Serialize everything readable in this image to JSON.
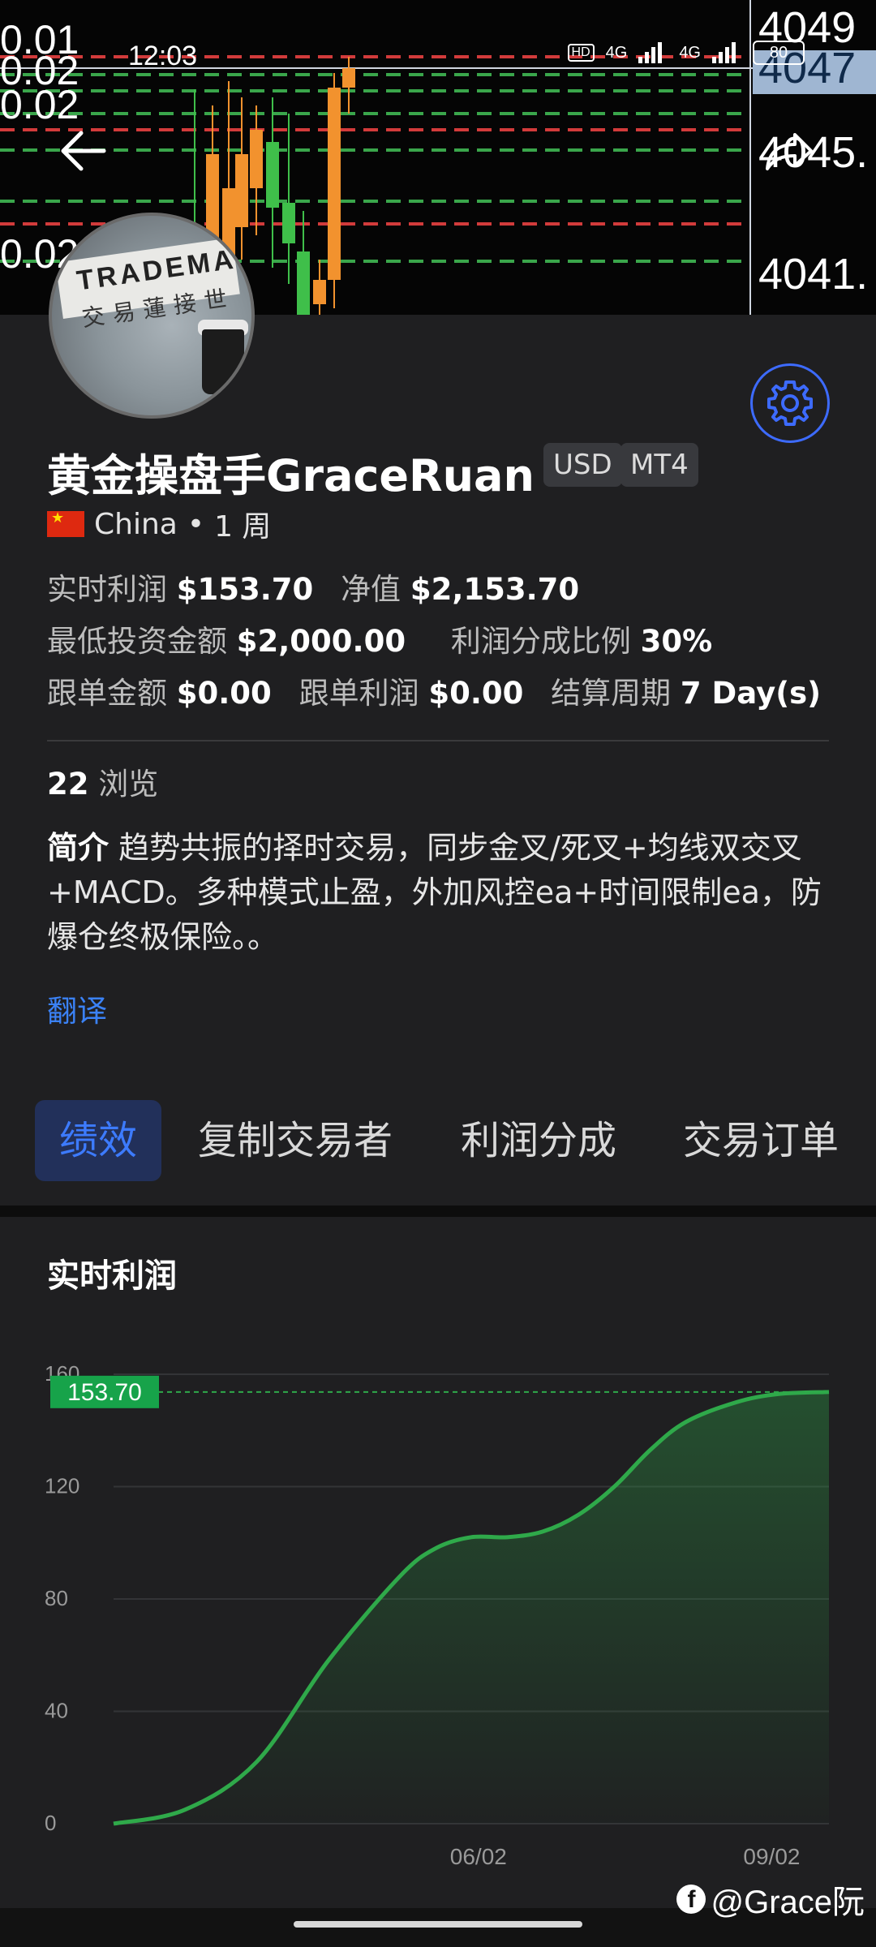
{
  "status_bar": {
    "time": "12:03",
    "network_hd": "HD",
    "net1": "4G",
    "net2": "4G",
    "battery": "80"
  },
  "banner": {
    "left_prices": [
      "0.01",
      "0.02",
      "0.02",
      "0.02"
    ],
    "right_prices": [
      "4049",
      "4047",
      "4045.",
      "4041."
    ]
  },
  "avatar": {
    "text1": "TRADEMA",
    "text2": "交易蓮接世"
  },
  "profile": {
    "name": "黄金操盘手GraceRuan",
    "tags": [
      "USD",
      "MT4"
    ],
    "country": "China",
    "duration": "1 周",
    "realtime_profit_label": "实时利润",
    "realtime_profit": "$153.70",
    "equity_label": "净值",
    "equity": "$2,153.70",
    "min_invest_label": "最低投资金额",
    "min_invest": "$2,000.00",
    "profit_share_label": "利润分成比例",
    "profit_share": "30%",
    "copy_amount_label": "跟单金额",
    "copy_amount": "$0.00",
    "copy_profit_label": "跟单利润",
    "copy_profit": "$0.00",
    "settlement_label": "结算周期",
    "settlement": "7 Day(s)",
    "views_count": "22",
    "views_label": "浏览",
    "intro_label": "简介",
    "intro_text": "趋势共振的择时交易，同步金叉/死叉+均线双交叉+MACD。多种模式止盈，外加风控ea+时间限制ea，防爆仓终极保险。。",
    "translate": "翻译"
  },
  "tabs": [
    "绩效",
    "复制交易者",
    "利润分成",
    "交易订单"
  ],
  "chart_section": {
    "title": "实时利润"
  },
  "chart_data": {
    "type": "area",
    "title": "实时利润",
    "x_tick_labels": [
      "06/02",
      "09/02"
    ],
    "y_ticks": [
      0,
      40,
      80,
      120,
      160
    ],
    "ylim": [
      0,
      160
    ],
    "current_value_label": "153.70",
    "series": [
      {
        "points": [
          [
            0,
            0
          ],
          [
            0.1,
            5
          ],
          [
            0.2,
            22
          ],
          [
            0.3,
            58
          ],
          [
            0.4,
            88
          ],
          [
            0.45,
            98
          ],
          [
            0.5,
            102
          ],
          [
            0.55,
            102
          ],
          [
            0.6,
            104
          ],
          [
            0.65,
            110
          ],
          [
            0.7,
            120
          ],
          [
            0.75,
            133
          ],
          [
            0.8,
            143
          ],
          [
            0.87,
            150
          ],
          [
            0.93,
            153
          ],
          [
            1.0,
            153.7
          ]
        ]
      }
    ],
    "line_color": "#2fa94a"
  },
  "watermark": {
    "text": "@Grace阮",
    "icon": "facebook-icon"
  }
}
